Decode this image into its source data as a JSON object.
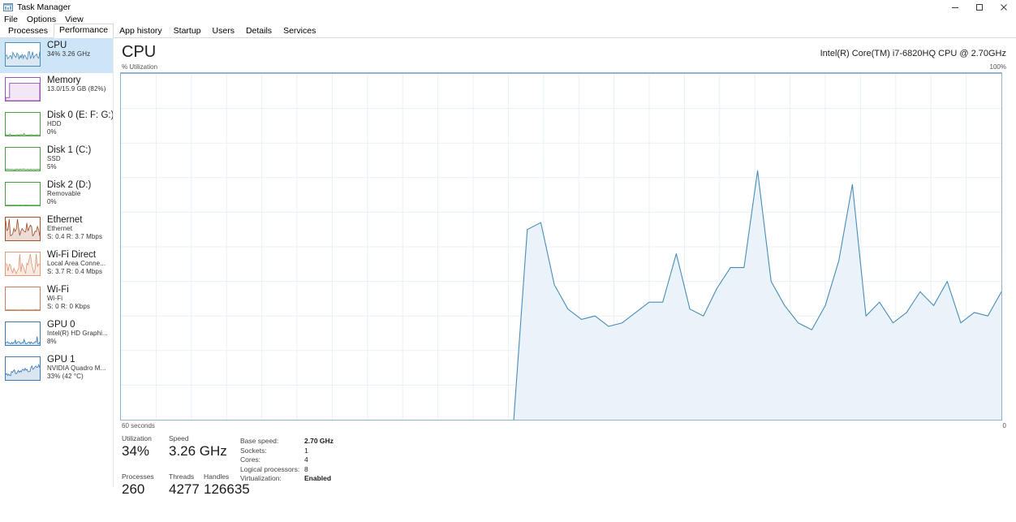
{
  "window": {
    "title": "Task Manager",
    "icon": "task-manager-icon",
    "minimize": "–",
    "maximize": "❐",
    "close": "✕"
  },
  "menu": [
    "File",
    "Options",
    "View"
  ],
  "tabs": [
    {
      "label": "Processes",
      "active": false
    },
    {
      "label": "Performance",
      "active": true
    },
    {
      "label": "App history",
      "active": false
    },
    {
      "label": "Startup",
      "active": false
    },
    {
      "label": "Users",
      "active": false
    },
    {
      "label": "Details",
      "active": false
    },
    {
      "label": "Services",
      "active": false
    }
  ],
  "sidebar": {
    "items": [
      {
        "name": "CPU",
        "line2": "34% 3.26 GHz",
        "line3": "",
        "selected": true,
        "color": "#4a8cb8",
        "icon": "cpu-sparkline-icon"
      },
      {
        "name": "Memory",
        "line2": "13.0/15.9 GB (82%)",
        "line3": "",
        "selected": false,
        "color": "#9a53b5",
        "icon": "memory-sparkline-icon"
      },
      {
        "name": "Disk 0 (E: F: G:)",
        "line2": "HDD",
        "line3": "0%",
        "selected": false,
        "color": "#4d9c43",
        "icon": "disk0-sparkline-icon"
      },
      {
        "name": "Disk 1 (C:)",
        "line2": "SSD",
        "line3": "5%",
        "selected": false,
        "color": "#4d9c43",
        "icon": "disk1-sparkline-icon"
      },
      {
        "name": "Disk 2 (D:)",
        "line2": "Removable",
        "line3": "0%",
        "selected": false,
        "color": "#4d9c43",
        "icon": "disk2-sparkline-icon"
      },
      {
        "name": "Ethernet",
        "line2": "Ethernet",
        "line3": "S: 0.4 R: 3.7 Mbps",
        "selected": false,
        "color": "#a0522d",
        "icon": "ethernet-sparkline-icon"
      },
      {
        "name": "Wi-Fi Direct",
        "line2": "Local Area Conne...",
        "line3": "S: 3.7 R: 0.4 Mbps",
        "selected": false,
        "color": "#e09a7a",
        "icon": "wifi-direct-sparkline-icon"
      },
      {
        "name": "Wi-Fi",
        "line2": "Wi-Fi",
        "line3": "S: 0 R: 0 Kbps",
        "selected": false,
        "color": "#c8805c",
        "icon": "wifi-sparkline-icon"
      },
      {
        "name": "GPU 0",
        "line2": "Intel(R) HD Graphi...",
        "line3": "8%",
        "selected": false,
        "color": "#3f7cb5",
        "icon": "gpu0-sparkline-icon"
      },
      {
        "name": "GPU 1",
        "line2": "NVIDIA Quadro M...",
        "line3": "33%  (42 °C)",
        "selected": false,
        "color": "#3f7cb5",
        "icon": "gpu1-sparkline-icon"
      }
    ]
  },
  "main": {
    "heading": "CPU",
    "model": "Intel(R) Core(TM) i7-6820HQ CPU @ 2.70GHz",
    "y_axis_label": "% Utilization",
    "y_axis_max": "100%",
    "x_axis_label": "60 seconds",
    "x_axis_min": "0",
    "stats": {
      "utilization": {
        "label": "Utilization",
        "value": "34%"
      },
      "speed": {
        "label": "Speed",
        "value": "3.26 GHz"
      },
      "processes": {
        "label": "Processes",
        "value": "260"
      },
      "threads": {
        "label": "Threads",
        "value": "4277"
      },
      "handles": {
        "label": "Handles",
        "value": "126635"
      }
    },
    "specs": [
      {
        "key": "Base speed:",
        "value": "2.70 GHz",
        "bold": true
      },
      {
        "key": "Sockets:",
        "value": "1",
        "bold": false
      },
      {
        "key": "Cores:",
        "value": "4",
        "bold": false
      },
      {
        "key": "Logical processors:",
        "value": "8",
        "bold": false
      },
      {
        "key": "Virtualization:",
        "value": "Enabled",
        "bold": true
      }
    ]
  },
  "colors": {
    "line": "#4a8cb8",
    "fill": "#eaf2fa",
    "grid": "#e9f1f8",
    "border": "#8fb4cd",
    "selection": "#cde6f7"
  },
  "chart_data": {
    "type": "area",
    "title": "% Utilization",
    "xlabel": "60 seconds",
    "ylabel": "% Utilization",
    "ylim": [
      0,
      100
    ],
    "xlim": [
      60,
      0
    ],
    "grid": true,
    "legend": null,
    "note": "Windows Task Manager CPU utilization over the last 60 seconds; left portion is blank (no history recorded yet).",
    "x": [
      0,
      1,
      2,
      3,
      4,
      5,
      6,
      7,
      8,
      9,
      10,
      11,
      12,
      13,
      14,
      15,
      16,
      17,
      18,
      19,
      20,
      21,
      22,
      23,
      24,
      25,
      26,
      27,
      28,
      29,
      30,
      31,
      32,
      33,
      34,
      35,
      36,
      37,
      38,
      39,
      40,
      41,
      42,
      43,
      44,
      45,
      46,
      47,
      48,
      49,
      50,
      51,
      52,
      53,
      54,
      55,
      56,
      57,
      58,
      59,
      60
    ],
    "values": [
      null,
      null,
      null,
      null,
      null,
      null,
      null,
      null,
      null,
      null,
      null,
      null,
      null,
      null,
      null,
      null,
      null,
      null,
      null,
      null,
      null,
      null,
      null,
      null,
      null,
      null,
      null,
      null,
      null,
      0,
      55,
      57,
      39,
      32,
      29,
      30,
      27,
      28,
      31,
      34,
      34,
      48,
      32,
      30,
      38,
      44,
      44,
      72,
      40,
      33,
      28,
      26,
      33,
      46,
      68,
      30,
      34,
      28,
      31,
      37,
      33,
      40,
      28,
      31,
      30,
      37
    ]
  }
}
